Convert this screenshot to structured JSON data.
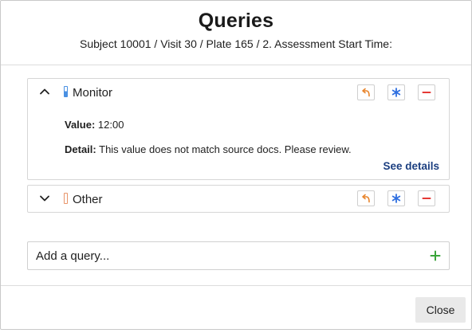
{
  "dialog": {
    "title": "Queries",
    "subtitle": "Subject 10001 / Visit 30 / Plate 165 / 2. Assessment Start Time:"
  },
  "queries": [
    {
      "name": "Monitor",
      "expanded": true,
      "flag_color": "#4a90e2",
      "value_label": "Value:",
      "value": "12:00",
      "detail_label": "Detail:",
      "detail": "This value does not match source docs. Please review.",
      "see_details_label": "See details",
      "icons": [
        "reply-icon",
        "asterisk-icon",
        "minus-icon"
      ]
    },
    {
      "name": "Other",
      "expanded": false,
      "flag_color": "#e8956a",
      "icons": [
        "reply-icon",
        "asterisk-icon",
        "minus-icon"
      ]
    }
  ],
  "add_query": {
    "placeholder": "Add a query...",
    "icon": "plus-icon"
  },
  "footer": {
    "close_label": "Close"
  },
  "colors": {
    "accent_blue": "#4a90e2",
    "link": "#1c3f80",
    "reply_orange": "#e8862e",
    "remove_red": "#e53935",
    "add_green": "#3aa53a"
  }
}
